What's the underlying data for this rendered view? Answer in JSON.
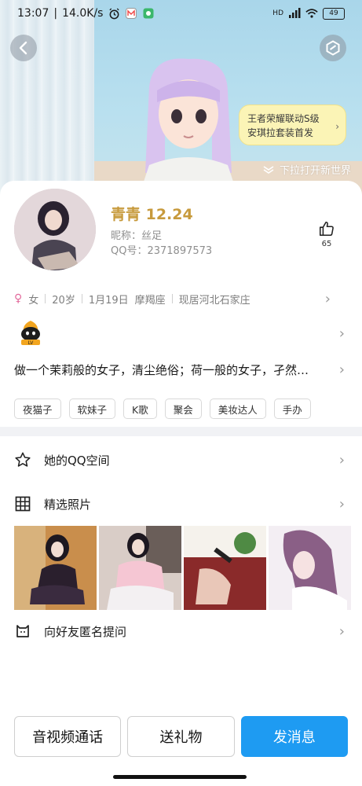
{
  "status_bar": {
    "time": "13:07",
    "speed": "14.0K/s",
    "battery": "49"
  },
  "promo": {
    "line1": "王者荣耀联动S级",
    "line2": "安琪拉套装首发"
  },
  "pull_hint": "下拉打开新世界",
  "profile": {
    "name": "青青 12.24",
    "nickname": "昵称：丝足",
    "qq": "QQ号：2371897573",
    "likes": "65"
  },
  "info": {
    "gender": "女",
    "age": "20岁",
    "birthday": "1月19日",
    "zodiac": "摩羯座",
    "location": "现居河北石家庄"
  },
  "signature": "做一个茉莉般的女子，清尘绝俗；荷一般的女子，孑然…",
  "tags": [
    "夜猫子",
    "软妹子",
    "K歌",
    "聚会",
    "美妆达人",
    "手办"
  ],
  "menu": {
    "qzone": "她的QQ空间",
    "photos": "精选照片",
    "anon": "向好友匿名提问"
  },
  "buttons": {
    "call": "音视频通话",
    "gift": "送礼物",
    "message": "发消息"
  },
  "colors": {
    "accent": "#1e9bf2",
    "name_gold": "#c79a3c"
  }
}
